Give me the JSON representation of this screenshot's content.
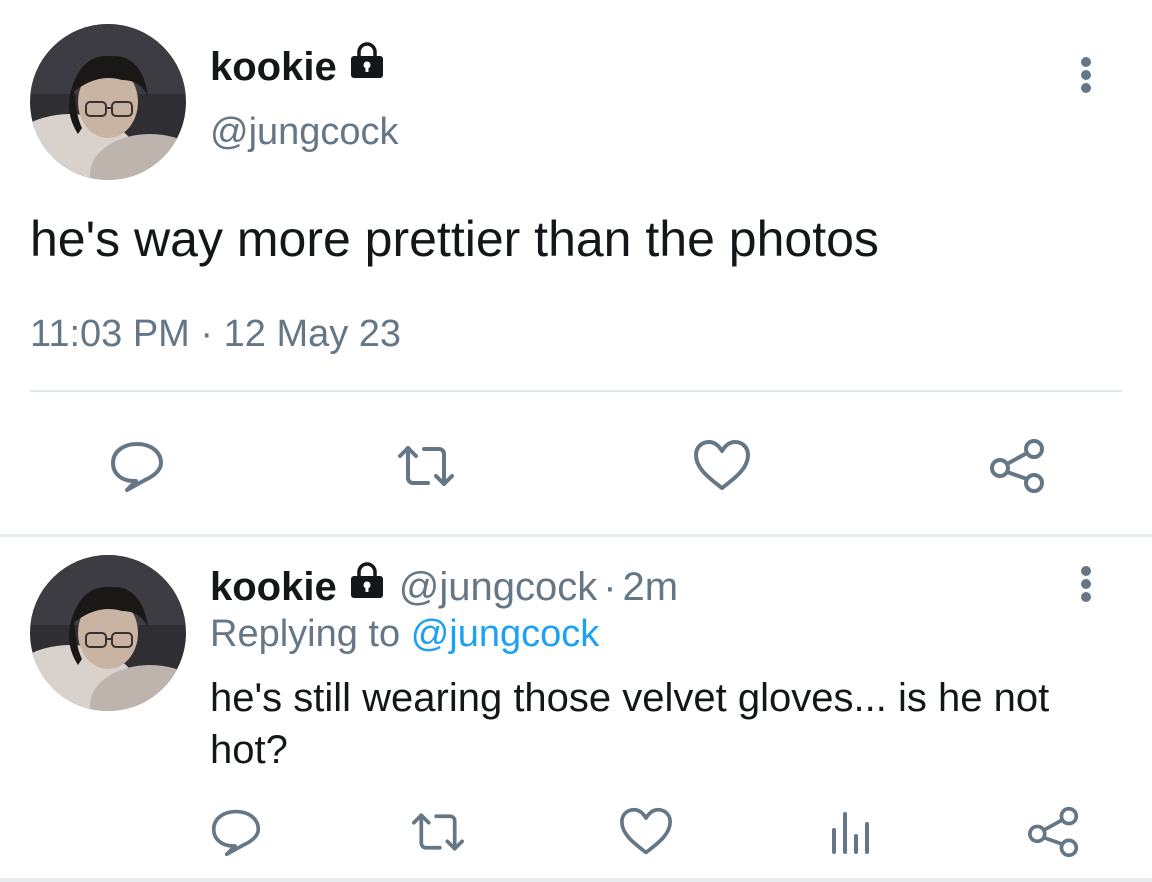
{
  "main_tweet": {
    "display_name": "kookie",
    "handle": "@jungcock",
    "text": "he's way more prettier than the photos",
    "time": "11:03 PM",
    "separator": "·",
    "date": "12 May 23",
    "icons": {
      "lock": "lock-icon",
      "more": "more-vertical-icon",
      "reply": "reply-icon",
      "retweet": "retweet-icon",
      "like": "heart-icon",
      "share": "share-icon"
    }
  },
  "reply_tweet": {
    "display_name": "kookie",
    "handle": "@jungcock",
    "separator": "·",
    "time_ago": "2m",
    "replying_prefix": "Replying to",
    "replying_to": "@jungcock",
    "text": "he's still wearing those velvet gloves... is he not hot?",
    "icons": {
      "lock": "lock-icon",
      "more": "more-vertical-icon",
      "reply": "reply-icon",
      "retweet": "retweet-icon",
      "like": "heart-icon",
      "analytics": "analytics-icon",
      "share": "share-icon"
    }
  },
  "colors": {
    "text": "#14171a",
    "secondary": "#657786",
    "accent": "#1da1f2",
    "divider": "#e1e8ed"
  }
}
